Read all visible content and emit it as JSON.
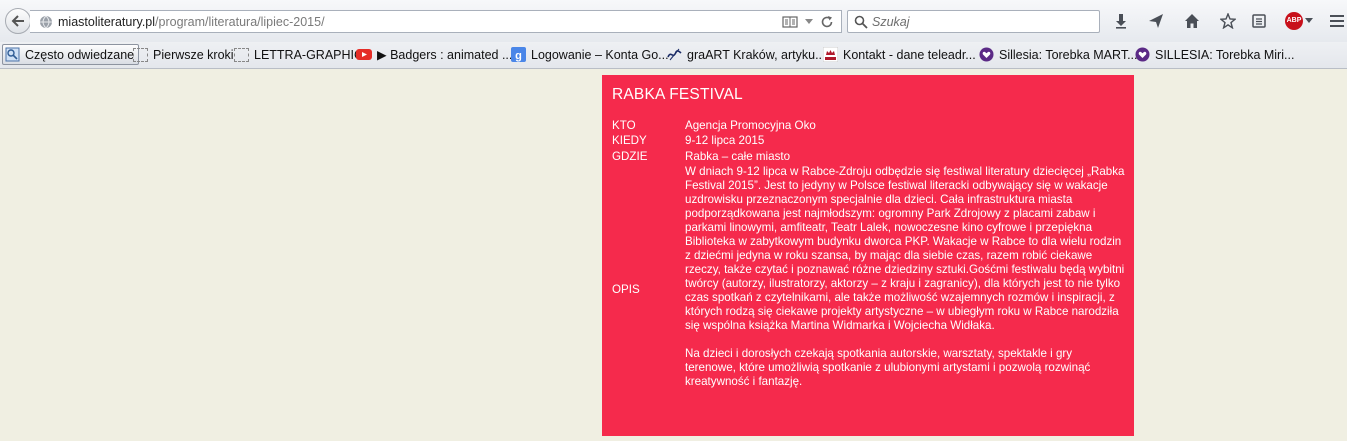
{
  "browser": {
    "url_domain": "miastoliteratury.pl",
    "url_path": "/program/literatura/lipiec-2015/",
    "search_placeholder": "Szukaj",
    "abp_label": "ABP"
  },
  "bookmarks": [
    {
      "label": "Często odwiedzane",
      "icon": "frequent-sites-icon"
    },
    {
      "label": "Pierwsze kroki",
      "icon": "page-icon"
    },
    {
      "label": "LETTRA-GRAPHIC",
      "icon": "page-icon"
    },
    {
      "label": "▶ Badgers : animated ...",
      "icon": "youtube-icon"
    },
    {
      "label": "Logowanie – Konta Go...",
      "icon": "google-icon"
    },
    {
      "label": "graART Kraków, artyku...",
      "icon": "graart-icon"
    },
    {
      "label": "Kontakt - dane teleadr...",
      "icon": "royal-icon"
    },
    {
      "label": "Sillesia: Torebka MART...",
      "icon": "heart-icon"
    },
    {
      "label": "SILLESIA: Torebka Miri...",
      "icon": "heart-icon"
    }
  ],
  "event": {
    "title": "RABKA FESTIVAL",
    "who_label": "KTO",
    "who": "Agencja Promocyjna Oko",
    "when_label": "KIEDY",
    "when": "9-12 lipca 2015",
    "where_label": "GDZIE",
    "where": "Rabka – całe miasto",
    "desc_label": "OPIS",
    "desc_p1": "W dniach 9-12 lipca w Rabce-Zdroju odbędzie się festiwal literatury dziecięcej „Rabka Festival 2015”. Jest to jedyny w Polsce festiwal literacki odbywający się w wakacje uzdrowisku przeznaczonym specjalnie dla dzieci. Cała infrastruktura miasta podporządkowana jest najmłodszym: ogromny Park Zdrojowy z placami zabaw i parkami linowymi, amfiteatr, Teatr Lalek, nowoczesne kino cyfrowe i przepiękna Biblioteka w zabytkowym budynku dworca PKP. Wakacje w Rabce to dla wielu rodzin z dziećmi jedyna w roku szansa, by mając dla siebie czas, razem robić ciekawe rzeczy, także czytać i poznawać różne dziedziny sztuki.Gośćmi festiwalu będą wybitni twórcy (autorzy, ilustratorzy, aktorzy – z kraju i zagranicy), dla których jest to nie tylko czas spotkań z czytelnikami, ale także możliwość wzajemnych rozmów i inspiracji, z których rodzą się ciekawe projekty artystyczne – w ubiegłym roku w Rabce narodziła się wspólna książka Martina Widmarka i Wojciecha Widłaka.",
    "desc_p2": "Na dzieci i dorosłych czekają spotkania autorskie, warsztaty, spektakle i gry terenowe, które umożliwią spotkanie z ulubionymi artystami i pozwolą rozwinąć kreatywność i fantazję."
  },
  "colors": {
    "card_background": "#f52a4c",
    "page_background": "#f0efe2"
  }
}
